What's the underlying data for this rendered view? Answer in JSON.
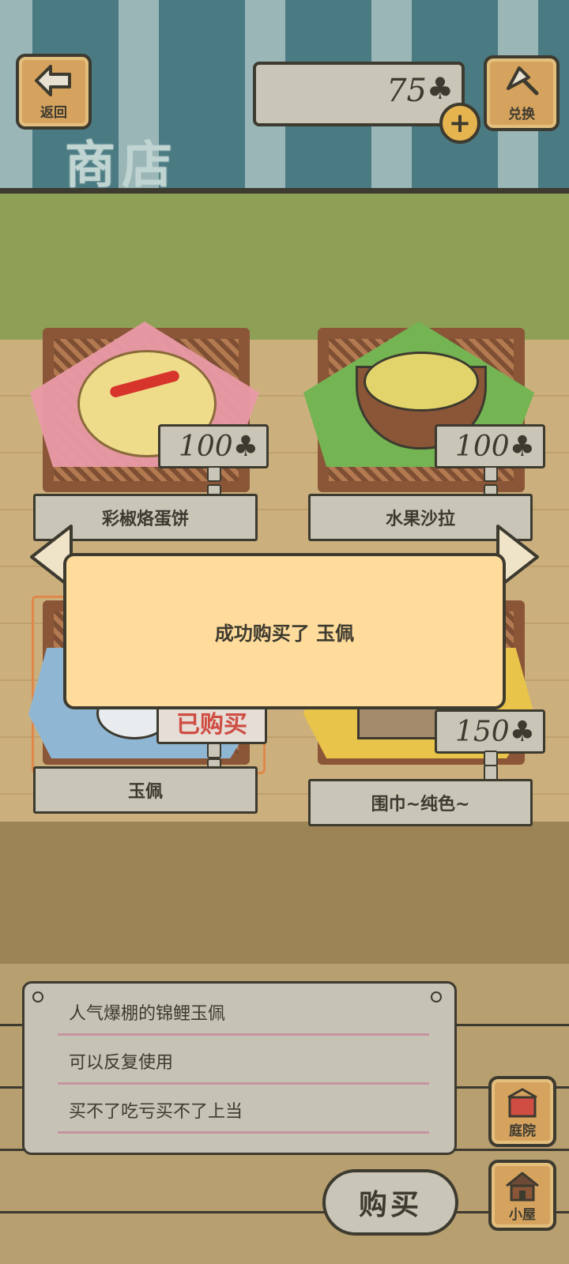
{
  "header": {
    "back_label": "返回",
    "exchange_label": "兑换",
    "currency_value": "75",
    "currency_icon": "clover-icon",
    "shop_title": "商店"
  },
  "items": [
    {
      "name": "彩椒烙蛋饼",
      "price": "100",
      "status": "price",
      "cloth_color": "#e99aa6"
    },
    {
      "name": "水果沙拉",
      "price": "100",
      "status": "price",
      "cloth_color": "#74b453"
    },
    {
      "name": "玉佩",
      "sold_label": "已购买",
      "status": "sold",
      "cloth_color": "#8fb7d4"
    },
    {
      "name": "围巾~纯色~",
      "price": "150",
      "status": "price",
      "cloth_color": "#e8c44a"
    }
  ],
  "popup": {
    "message": "成功购买了 玉佩"
  },
  "description": {
    "lines": [
      "人气爆棚的锦鲤玉佩",
      "可以反复使用",
      "买不了吃亏买不了上当"
    ]
  },
  "buy_label": "购买",
  "nav": {
    "yard_label": "庭院",
    "house_label": "小屋"
  },
  "colors": {
    "awning_dark": "#4a7b83",
    "awning_light": "#9ab6b7",
    "popup_bg": "#ffdc9b",
    "sold_red": "#cf4d43"
  }
}
